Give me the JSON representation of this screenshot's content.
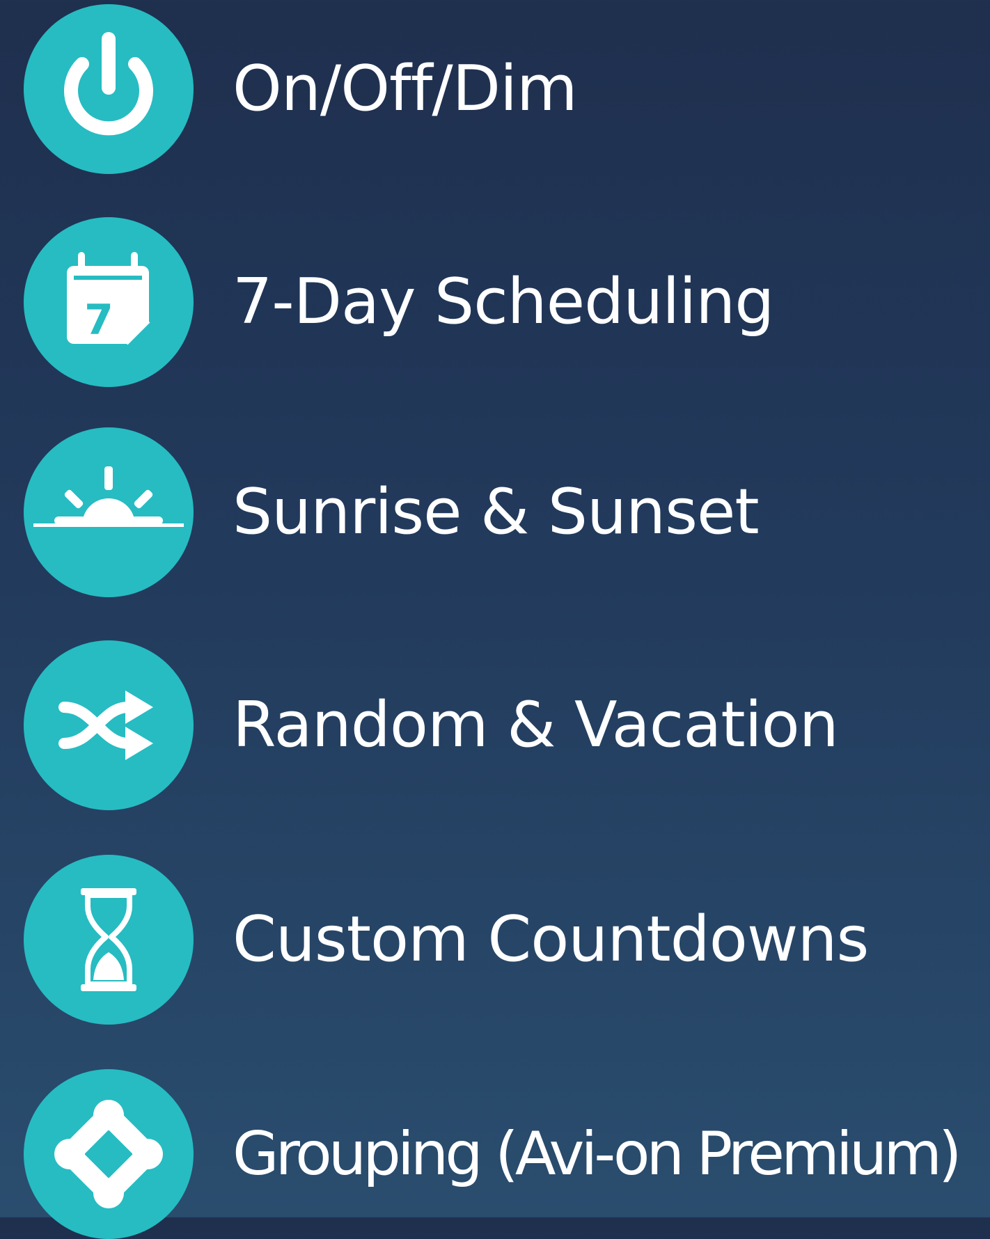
{
  "colors": {
    "background_top": "#1f2f4e",
    "background_bottom": "#2a4d6e",
    "icon_circle": "#26bcc2",
    "text": "#ffffff"
  },
  "features": [
    {
      "label": "On/Off/Dim",
      "icon": "power-icon"
    },
    {
      "label": "7-Day Scheduling",
      "icon": "calendar-icon",
      "icon_text": "7"
    },
    {
      "label": "Sunrise & Sunset",
      "icon": "sunrise-icon"
    },
    {
      "label": "Random & Vacation",
      "icon": "shuffle-icon"
    },
    {
      "label": "Custom Countdowns",
      "icon": "hourglass-icon"
    },
    {
      "label": "Grouping (Avi-on Premium)",
      "icon": "grouping-icon"
    }
  ]
}
